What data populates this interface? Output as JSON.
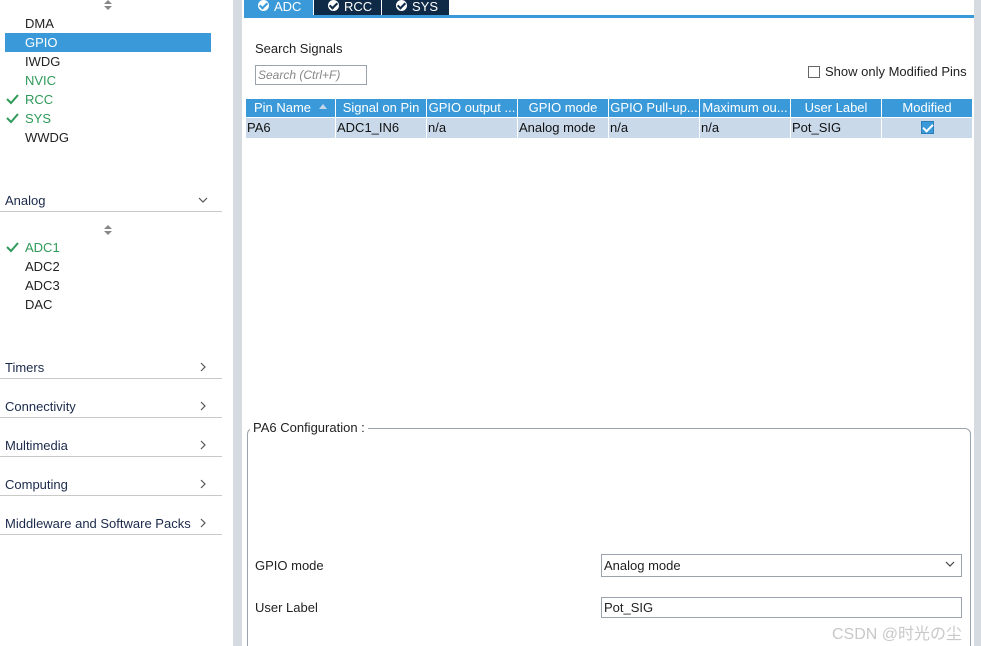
{
  "system_items": [
    {
      "label": "DMA",
      "state": "normal"
    },
    {
      "label": "GPIO",
      "state": "selected"
    },
    {
      "label": "IWDG",
      "state": "normal"
    },
    {
      "label": "NVIC",
      "state": "green"
    },
    {
      "label": "RCC",
      "state": "checked"
    },
    {
      "label": "SYS",
      "state": "checked"
    },
    {
      "label": "WWDG",
      "state": "normal"
    }
  ],
  "analog": {
    "label": "Analog",
    "items": [
      {
        "label": "ADC1",
        "state": "checked"
      },
      {
        "label": "ADC2",
        "state": "normal"
      },
      {
        "label": "ADC3",
        "state": "normal"
      },
      {
        "label": "DAC",
        "state": "normal"
      }
    ]
  },
  "categories": [
    "Timers",
    "Connectivity",
    "Multimedia",
    "Computing",
    "Middleware and Software Packs"
  ],
  "tabs": [
    {
      "label": "ADC",
      "active": true
    },
    {
      "label": "RCC",
      "active": false
    },
    {
      "label": "SYS",
      "active": false
    }
  ],
  "search": {
    "title": "Search Signals",
    "placeholder": "Search (Ctrl+F)"
  },
  "show_modified": {
    "label": "Show only Modified Pins",
    "checked": false
  },
  "table": {
    "columns": [
      "Pin Name",
      "Signal on Pin",
      "GPIO output ...",
      "GPIO mode",
      "GPIO Pull-up...",
      "Maximum ou...",
      "User Label",
      "Modified"
    ],
    "rows": [
      {
        "pin": "PA6",
        "signal": "ADC1_IN6",
        "output": "n/a",
        "mode": "Analog mode",
        "pull": "n/a",
        "max": "n/a",
        "label": "Pot_SIG",
        "modified": true
      }
    ]
  },
  "config": {
    "title": "PA6 Configuration :",
    "gpio_mode_label": "GPIO mode",
    "gpio_mode_value": "Analog mode",
    "user_label_label": "User Label",
    "user_label_value": "Pot_SIG"
  },
  "colors": {
    "accent": "#3a9ad9",
    "green": "#2f9a59",
    "tab_dark": "#0e2a47",
    "row_selected": "#c9d9ea"
  },
  "watermark": "CSDN @时光の尘"
}
